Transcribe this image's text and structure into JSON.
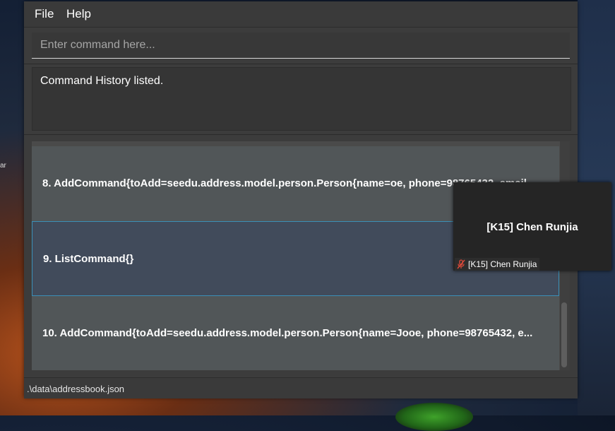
{
  "menu": {
    "file": "File",
    "help": "Help"
  },
  "command": {
    "placeholder": "Enter command here...",
    "value": ""
  },
  "result": {
    "text": "Command History listed."
  },
  "history": [
    {
      "label": "8.  AddCommand{toAdd=seedu.address.model.person.Person{name=oe, phone=98765432, email"
    },
    {
      "label": "9.  ListCommand{}"
    },
    {
      "label": "10.  AddCommand{toAdd=seedu.address.model.person.Person{name=Jooe, phone=98765432, e..."
    }
  ],
  "status": {
    "path": ".\\data\\addressbook.json"
  },
  "video": {
    "name": "[K15] Chen Runjia",
    "label": "[K15] Chen Runjia",
    "icon": "mic-muted-icon"
  },
  "desktop": {
    "left_text": "ar"
  },
  "colors": {
    "accent": "#3a8fb7",
    "selected_row": "#414b5b",
    "row": "#515658"
  }
}
